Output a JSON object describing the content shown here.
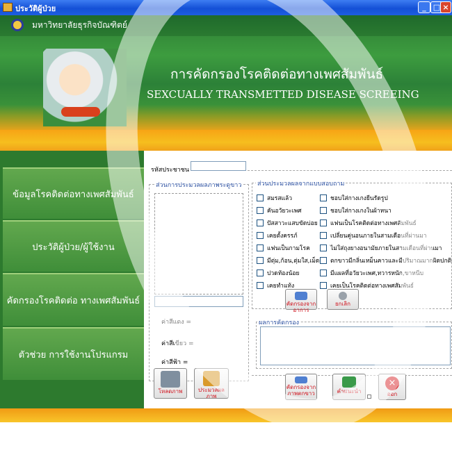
{
  "window": {
    "title": "ประวัติผู้ป่วย"
  },
  "header": {
    "university": "มหาวิทยาลัยธุรกิจบัณฑิตย์",
    "title_th": "การคัดกรองโรคติดต่อทางเพศสัมพันธ์",
    "title_en": "SEXCUALLY TRANSMETTED DISEASE SCREEING"
  },
  "sidebar": {
    "items": [
      {
        "label": "ข้อมูลโรคติดต่อทางเพศสัมพันธ์"
      },
      {
        "label": "ประวัติผู้ป่วย/ผู้ใช้งาน"
      },
      {
        "label": "คัดกรองโรคติดต่อ ทางเพศสัมพันธ์"
      },
      {
        "label": "ตัวช่วย การใช้งานโปรแกรม"
      }
    ]
  },
  "form": {
    "id_label": "รหัสประชาชน",
    "id_value": "",
    "image_group_title": "ส่วนการประมวลผลภาพระดูขาว",
    "questionnaire_title": "ส่วนประมวลผลจากแบบสอบถาม",
    "checkboxes_left": [
      "สมรสแล้ว",
      "คันอวัยวะเพศ",
      "ปัสสาวะแสบขัดบ่อย",
      "เคยตั้งครรภ์",
      "แฟนเป็นกามโรค",
      "มีตุ่ม,ก้อน,ตุ่มใส,เม็ด",
      "ปวดท้องน้อย",
      "เคยทำแท้ง"
    ],
    "checkboxes_right": [
      "ชอบใส่กางเกงยีนรัดรูป",
      "ชอบใส่กางเกงในผ้าหนา",
      "แฟนเป็นโรคติดต่อทางเพศสัมพันธ์",
      "เปลี่ยนคู่นอนภายในสามเดือนที่ผ่านมา",
      "ไม่ใส่ถุงยางอนามัยภายในสามเดือนที่ผ่านมา",
      "ตกขาวมีกลิ่นเหม็นคาวและมีปริมาณมากผิดปกติ",
      "มีแผลที่อวัยวะเพศ,ทวารหนัก,ขาหนีบ",
      "เคยเป็นโรคติดต่อทางเพศสัมพันธ์"
    ],
    "screen_q_button": "คัดกรองจากอาการ",
    "cancel_button": "ยกเลิก",
    "result_title": "ผลการคัดกรอง",
    "red_label": "ค่าสีแดง =",
    "green_label": "ค่าสีเขียว =",
    "blue_label": "ค่าสีฟ้า =",
    "load_image_button": "โหลดภาพ",
    "process_image_button": "ประมวลผลภาพ",
    "screen_img_button": "คัดกรองจากภาพตกขาว",
    "advice_button": "คำแนะนำ",
    "exit_button": "ออก"
  },
  "colors": {
    "green": "#3d9c3f",
    "orange": "#f6be1e",
    "title_blue": "#1450d6"
  }
}
